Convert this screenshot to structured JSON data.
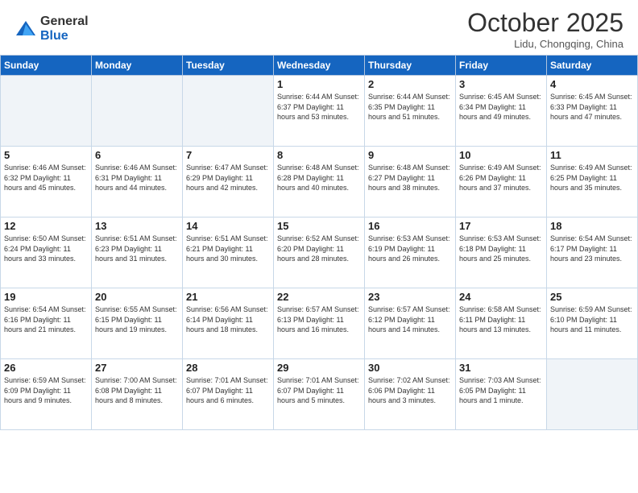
{
  "header": {
    "logo_general": "General",
    "logo_blue": "Blue",
    "month_title": "October 2025",
    "location": "Lidu, Chongqing, China"
  },
  "calendar": {
    "weekdays": [
      "Sunday",
      "Monday",
      "Tuesday",
      "Wednesday",
      "Thursday",
      "Friday",
      "Saturday"
    ],
    "rows": [
      [
        {
          "num": "",
          "info": ""
        },
        {
          "num": "",
          "info": ""
        },
        {
          "num": "",
          "info": ""
        },
        {
          "num": "1",
          "info": "Sunrise: 6:44 AM\nSunset: 6:37 PM\nDaylight: 11 hours\nand 53 minutes."
        },
        {
          "num": "2",
          "info": "Sunrise: 6:44 AM\nSunset: 6:35 PM\nDaylight: 11 hours\nand 51 minutes."
        },
        {
          "num": "3",
          "info": "Sunrise: 6:45 AM\nSunset: 6:34 PM\nDaylight: 11 hours\nand 49 minutes."
        },
        {
          "num": "4",
          "info": "Sunrise: 6:45 AM\nSunset: 6:33 PM\nDaylight: 11 hours\nand 47 minutes."
        }
      ],
      [
        {
          "num": "5",
          "info": "Sunrise: 6:46 AM\nSunset: 6:32 PM\nDaylight: 11 hours\nand 45 minutes."
        },
        {
          "num": "6",
          "info": "Sunrise: 6:46 AM\nSunset: 6:31 PM\nDaylight: 11 hours\nand 44 minutes."
        },
        {
          "num": "7",
          "info": "Sunrise: 6:47 AM\nSunset: 6:29 PM\nDaylight: 11 hours\nand 42 minutes."
        },
        {
          "num": "8",
          "info": "Sunrise: 6:48 AM\nSunset: 6:28 PM\nDaylight: 11 hours\nand 40 minutes."
        },
        {
          "num": "9",
          "info": "Sunrise: 6:48 AM\nSunset: 6:27 PM\nDaylight: 11 hours\nand 38 minutes."
        },
        {
          "num": "10",
          "info": "Sunrise: 6:49 AM\nSunset: 6:26 PM\nDaylight: 11 hours\nand 37 minutes."
        },
        {
          "num": "11",
          "info": "Sunrise: 6:49 AM\nSunset: 6:25 PM\nDaylight: 11 hours\nand 35 minutes."
        }
      ],
      [
        {
          "num": "12",
          "info": "Sunrise: 6:50 AM\nSunset: 6:24 PM\nDaylight: 11 hours\nand 33 minutes."
        },
        {
          "num": "13",
          "info": "Sunrise: 6:51 AM\nSunset: 6:23 PM\nDaylight: 11 hours\nand 31 minutes."
        },
        {
          "num": "14",
          "info": "Sunrise: 6:51 AM\nSunset: 6:21 PM\nDaylight: 11 hours\nand 30 minutes."
        },
        {
          "num": "15",
          "info": "Sunrise: 6:52 AM\nSunset: 6:20 PM\nDaylight: 11 hours\nand 28 minutes."
        },
        {
          "num": "16",
          "info": "Sunrise: 6:53 AM\nSunset: 6:19 PM\nDaylight: 11 hours\nand 26 minutes."
        },
        {
          "num": "17",
          "info": "Sunrise: 6:53 AM\nSunset: 6:18 PM\nDaylight: 11 hours\nand 25 minutes."
        },
        {
          "num": "18",
          "info": "Sunrise: 6:54 AM\nSunset: 6:17 PM\nDaylight: 11 hours\nand 23 minutes."
        }
      ],
      [
        {
          "num": "19",
          "info": "Sunrise: 6:54 AM\nSunset: 6:16 PM\nDaylight: 11 hours\nand 21 minutes."
        },
        {
          "num": "20",
          "info": "Sunrise: 6:55 AM\nSunset: 6:15 PM\nDaylight: 11 hours\nand 19 minutes."
        },
        {
          "num": "21",
          "info": "Sunrise: 6:56 AM\nSunset: 6:14 PM\nDaylight: 11 hours\nand 18 minutes."
        },
        {
          "num": "22",
          "info": "Sunrise: 6:57 AM\nSunset: 6:13 PM\nDaylight: 11 hours\nand 16 minutes."
        },
        {
          "num": "23",
          "info": "Sunrise: 6:57 AM\nSunset: 6:12 PM\nDaylight: 11 hours\nand 14 minutes."
        },
        {
          "num": "24",
          "info": "Sunrise: 6:58 AM\nSunset: 6:11 PM\nDaylight: 11 hours\nand 13 minutes."
        },
        {
          "num": "25",
          "info": "Sunrise: 6:59 AM\nSunset: 6:10 PM\nDaylight: 11 hours\nand 11 minutes."
        }
      ],
      [
        {
          "num": "26",
          "info": "Sunrise: 6:59 AM\nSunset: 6:09 PM\nDaylight: 11 hours\nand 9 minutes."
        },
        {
          "num": "27",
          "info": "Sunrise: 7:00 AM\nSunset: 6:08 PM\nDaylight: 11 hours\nand 8 minutes."
        },
        {
          "num": "28",
          "info": "Sunrise: 7:01 AM\nSunset: 6:07 PM\nDaylight: 11 hours\nand 6 minutes."
        },
        {
          "num": "29",
          "info": "Sunrise: 7:01 AM\nSunset: 6:07 PM\nDaylight: 11 hours\nand 5 minutes."
        },
        {
          "num": "30",
          "info": "Sunrise: 7:02 AM\nSunset: 6:06 PM\nDaylight: 11 hours\nand 3 minutes."
        },
        {
          "num": "31",
          "info": "Sunrise: 7:03 AM\nSunset: 6:05 PM\nDaylight: 11 hours\nand 1 minute."
        },
        {
          "num": "",
          "info": ""
        }
      ]
    ]
  }
}
